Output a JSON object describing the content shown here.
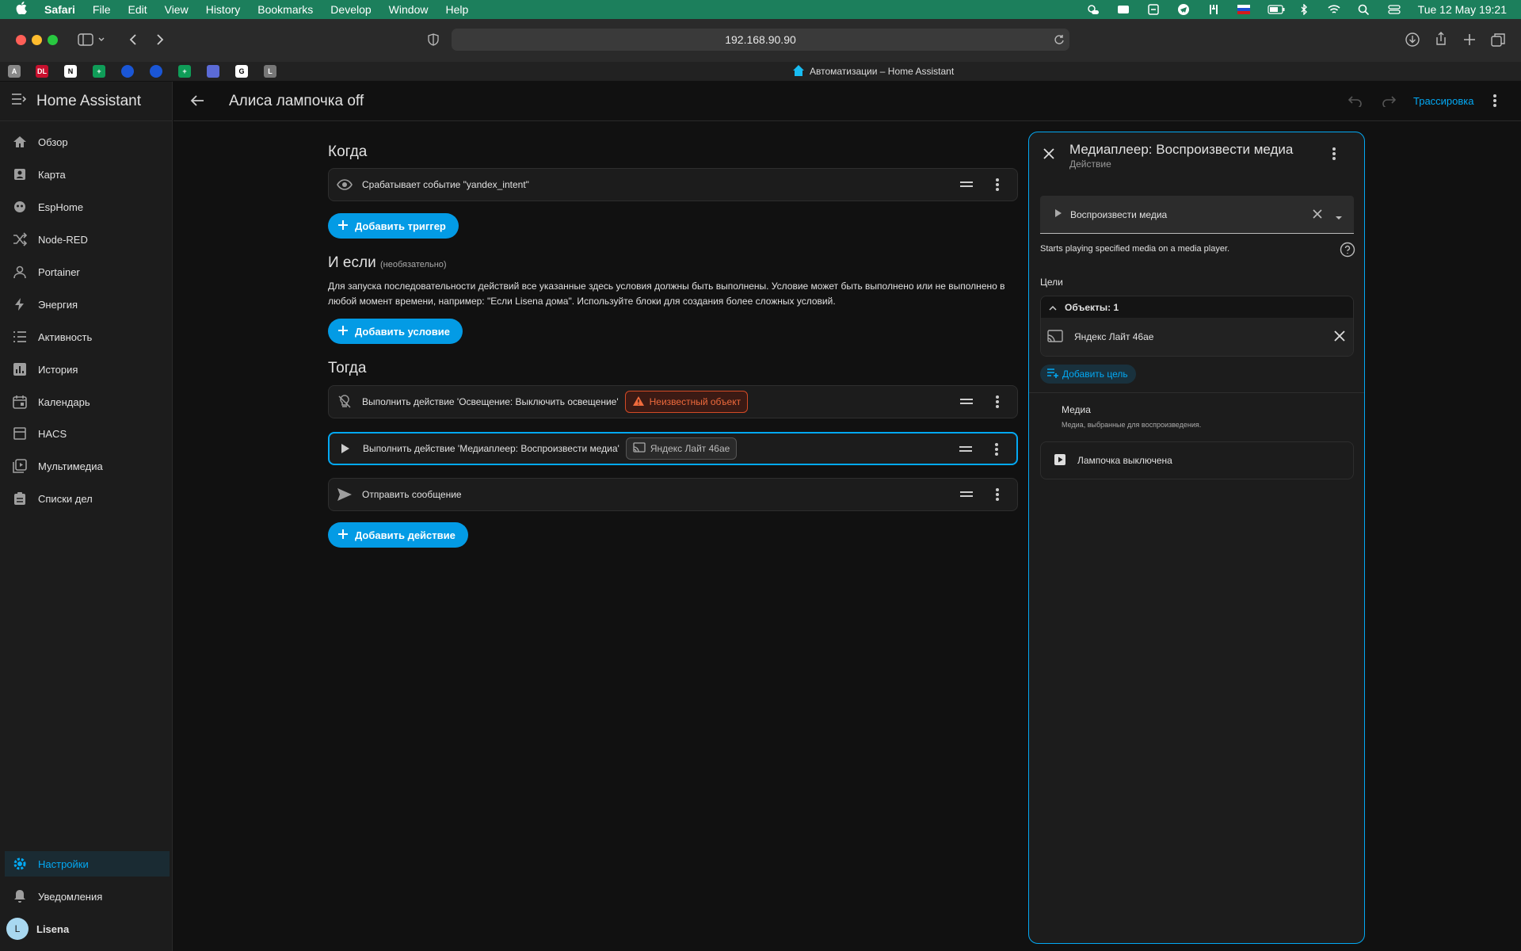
{
  "menubar": {
    "app": "Safari",
    "items": [
      "File",
      "Edit",
      "View",
      "History",
      "Bookmarks",
      "Develop",
      "Window",
      "Help"
    ],
    "clock": "Tue 12 May  19:21"
  },
  "browser": {
    "url": "192.168.90.90",
    "tab_title": "Автоматизации – Home Assistant",
    "favicons": [
      "A",
      "DL",
      "N",
      "+",
      "",
      "",
      "+",
      "",
      "G",
      "L"
    ]
  },
  "sidebar": {
    "title": "Home Assistant",
    "items": [
      {
        "label": "Обзор",
        "icon": "home-icon"
      },
      {
        "label": "Карта",
        "icon": "map-icon"
      },
      {
        "label": "EspHome",
        "icon": "esphome-icon"
      },
      {
        "label": "Node-RED",
        "icon": "shuffle-icon"
      },
      {
        "label": "Portainer",
        "icon": "portainer-icon"
      },
      {
        "label": "Энергия",
        "icon": "lightning-icon"
      },
      {
        "label": "Активность",
        "icon": "list-icon"
      },
      {
        "label": "История",
        "icon": "chart-icon"
      },
      {
        "label": "Календарь",
        "icon": "calendar-icon"
      },
      {
        "label": "HACS",
        "icon": "hacs-icon"
      },
      {
        "label": "Мультимедиа",
        "icon": "media-icon"
      },
      {
        "label": "Списки дел",
        "icon": "clipboard-icon"
      }
    ],
    "settings": "Настройки",
    "notifications": "Уведомления",
    "user": "Lisena",
    "user_initial": "L"
  },
  "topbar": {
    "title": "Алиса лампочка off",
    "trace": "Трассировка"
  },
  "editor": {
    "when_title": "Когда",
    "trigger": "Срабатывает событие \"yandex_intent\"",
    "add_trigger": "Добавить триггер",
    "if_title": "И если",
    "if_optional": "(необязательно)",
    "if_desc": "Для запуска последовательности действий все указанные здесь условия должны быть выполнены. Условие может быть выполнено или не выполнено в любой момент времени, например: \"Если Lisena дома\". Используйте блоки для создания более сложных условий.",
    "add_condition": "Добавить условие",
    "then_title": "Тогда",
    "action1": "Выполнить действие 'Освещение: Выключить освещение'",
    "action1_chip": "Неизвестный объект",
    "action2": "Выполнить действие 'Медиаплеер: Воспроизвести медиа'",
    "action2_chip": "Яндекс Лайт 46ae",
    "action3": "Отправить сообщение",
    "add_action": "Добавить действие"
  },
  "panel": {
    "title": "Медиаплеер: Воспроизвести медиа",
    "subtitle": "Действие",
    "action_select": "Воспроизвести медиа",
    "description": "Starts playing specified media on a media player.",
    "targets_label": "Цели",
    "objects_header": "Объекты: 1",
    "target_entity": "Яндекс Лайт 46ae",
    "add_target": "Добавить цель",
    "media_label": "Медиа",
    "media_desc": "Медиа, выбранные для воспроизведения.",
    "media_value": "Лампочка выключена"
  },
  "colors": {
    "accent": "#03a9f4",
    "button": "#039be5",
    "warning": "#ef6a3c",
    "menubar": "#1c7f5c"
  }
}
